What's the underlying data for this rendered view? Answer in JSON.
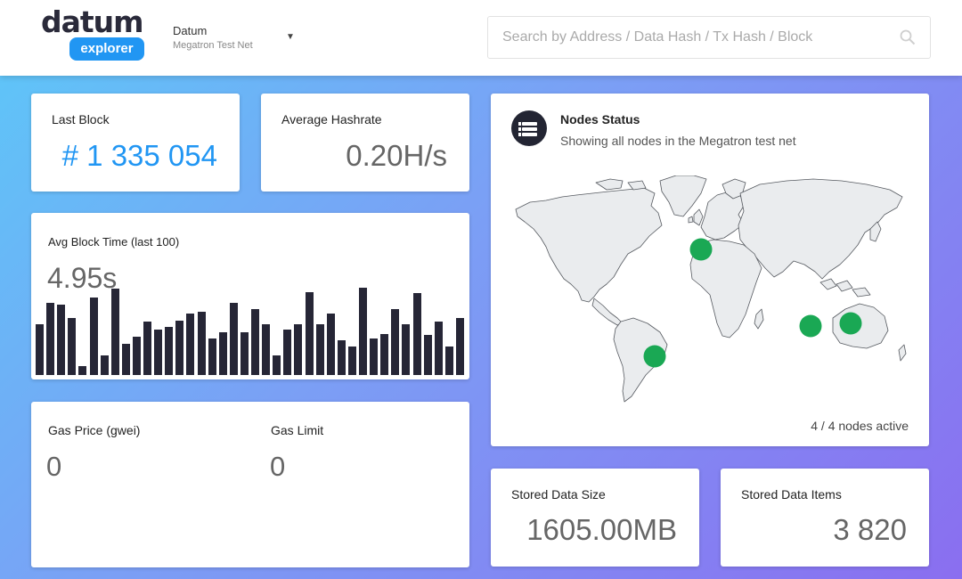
{
  "header": {
    "logo_word": "datum",
    "logo_pill": "explorer",
    "network_name": "Datum",
    "network_sub": "Megatron Test Net",
    "search_placeholder": "Search by Address / Data Hash / Tx Hash / Block"
  },
  "last_block": {
    "label": "Last Block",
    "value": "# 1 335 054",
    "accent": "#2196f3"
  },
  "hashrate": {
    "label": "Average Hashrate",
    "value": "0.20H/s"
  },
  "block_time": {
    "label": "Avg Block Time (last 100)",
    "value": "4.95s",
    "bars": [
      56,
      79,
      77,
      63,
      10,
      85,
      22,
      95,
      34,
      42,
      59,
      50,
      53,
      60,
      68,
      70,
      40,
      47,
      79,
      47,
      72,
      56,
      22,
      50,
      56,
      91,
      56,
      68,
      38,
      31,
      96,
      40,
      45,
      72,
      56,
      90,
      44,
      59,
      31,
      63
    ]
  },
  "gas_price": {
    "label": "Gas Price (gwei)",
    "value": "0"
  },
  "gas_limit": {
    "label": "Gas Limit",
    "value": "0"
  },
  "nodes": {
    "title": "Nodes Status",
    "subtitle": "Showing all nodes in the Megatron test net",
    "active_text": "4 / 4 nodes active",
    "marker_color": "#1aa854"
  },
  "stored_size": {
    "label": "Stored Data Size",
    "value": "1605.00MB"
  },
  "stored_items": {
    "label": "Stored Data Items",
    "value": "3 820"
  }
}
